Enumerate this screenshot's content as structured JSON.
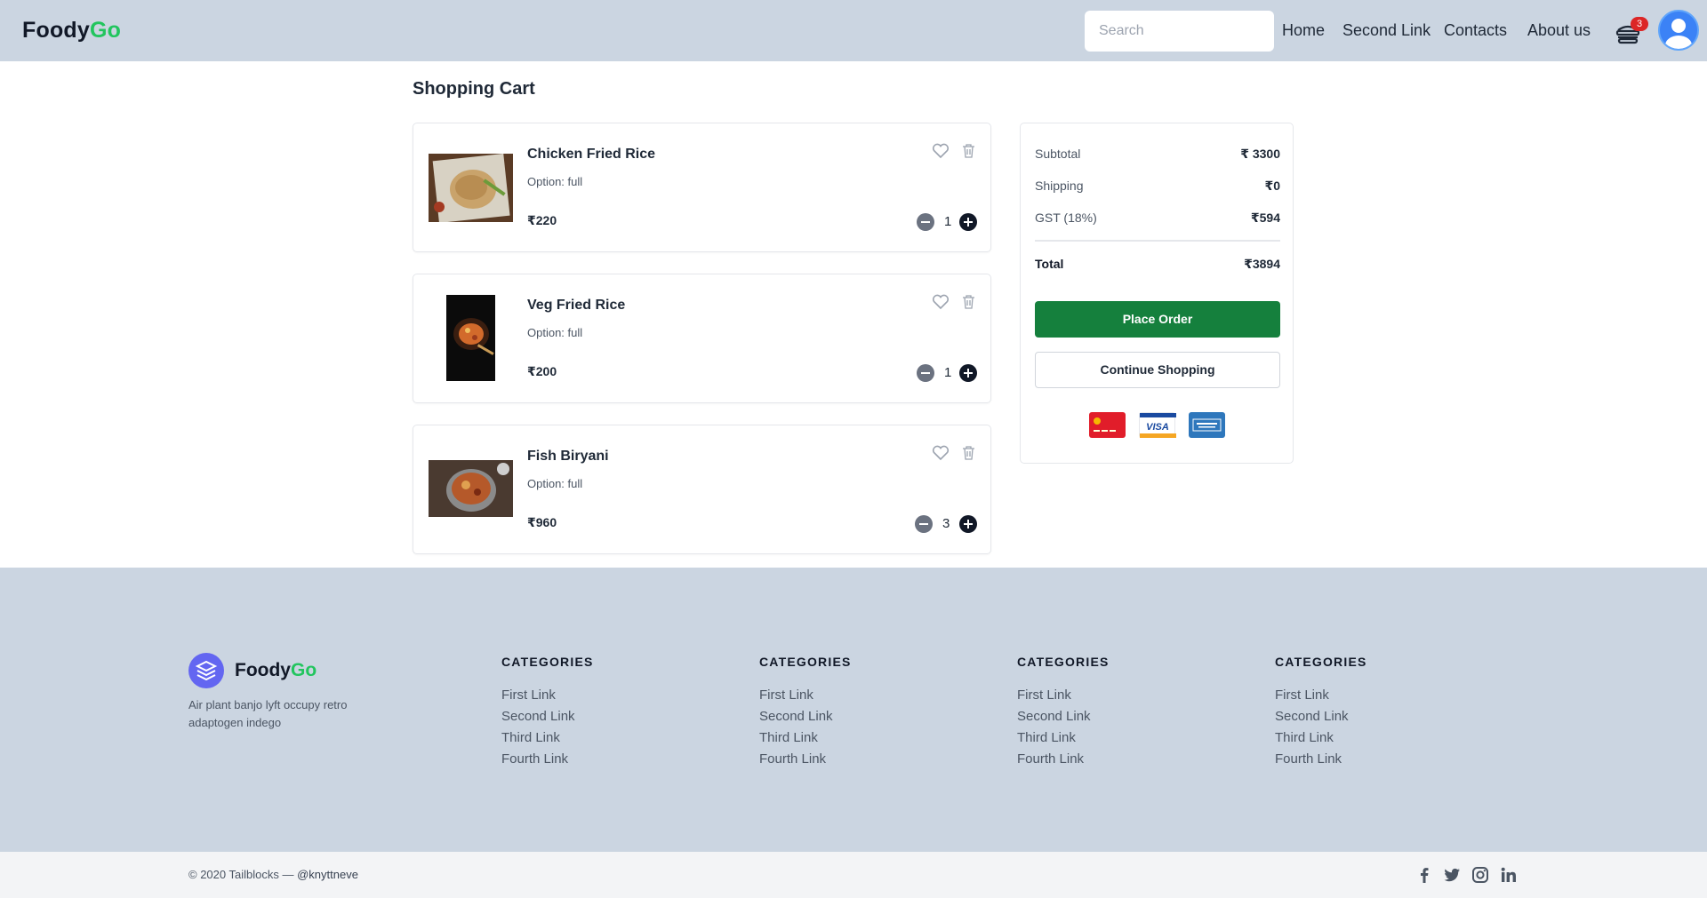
{
  "header": {
    "brand_main": "Foody",
    "brand_accent": "Go",
    "search_placeholder": "Search",
    "nav": [
      "Home",
      "Second Link",
      "Contacts",
      "About us"
    ],
    "cart_count": "3"
  },
  "cart": {
    "title": "Shopping Cart",
    "items": [
      {
        "name": "Chicken Fried Rice",
        "option": "Option: full",
        "price": "₹220",
        "qty": "1"
      },
      {
        "name": "Veg Fried Rice",
        "option": "Option: full",
        "price": "₹200",
        "qty": "1"
      },
      {
        "name": "Fish Biryani",
        "option": "Option: full",
        "price": "₹960",
        "qty": "3"
      }
    ]
  },
  "summary": {
    "subtotal_label": "Subtotal",
    "subtotal_value": "₹ 3300",
    "shipping_label": "Shipping",
    "shipping_value": "₹0",
    "gst_label": "GST (18%)",
    "gst_value": "₹594",
    "total_label": "Total",
    "total_value": "₹3894",
    "place_order": "Place Order",
    "continue_shopping": "Continue Shopping",
    "payment_icons": [
      "credit-card-icon",
      "visa-icon",
      "amex-icon"
    ]
  },
  "footer": {
    "brand_main": "Foody",
    "brand_accent": "Go",
    "description": "Air plant banjo lyft occupy retro adaptogen indego",
    "columns": [
      {
        "heading": "CATEGORIES",
        "links": [
          "First Link",
          "Second Link",
          "Third Link",
          "Fourth Link"
        ]
      },
      {
        "heading": "CATEGORIES",
        "links": [
          "First Link",
          "Second Link",
          "Third Link",
          "Fourth Link"
        ]
      },
      {
        "heading": "CATEGORIES",
        "links": [
          "First Link",
          "Second Link",
          "Third Link",
          "Fourth Link"
        ]
      },
      {
        "heading": "CATEGORIES",
        "links": [
          "First Link",
          "Second Link",
          "Third Link",
          "Fourth Link"
        ]
      }
    ],
    "copyright": "© 2020 Tailblocks —",
    "handle": "@knyttneve",
    "social": [
      "facebook-icon",
      "twitter-icon",
      "instagram-icon",
      "linkedin-icon"
    ]
  },
  "colors": {
    "header_bg": "#cbd5e1",
    "brand_accent": "#22c55e",
    "place_order_bg": "#15803d",
    "badge": "#dc2626",
    "footer_logo": "#6366f1"
  }
}
